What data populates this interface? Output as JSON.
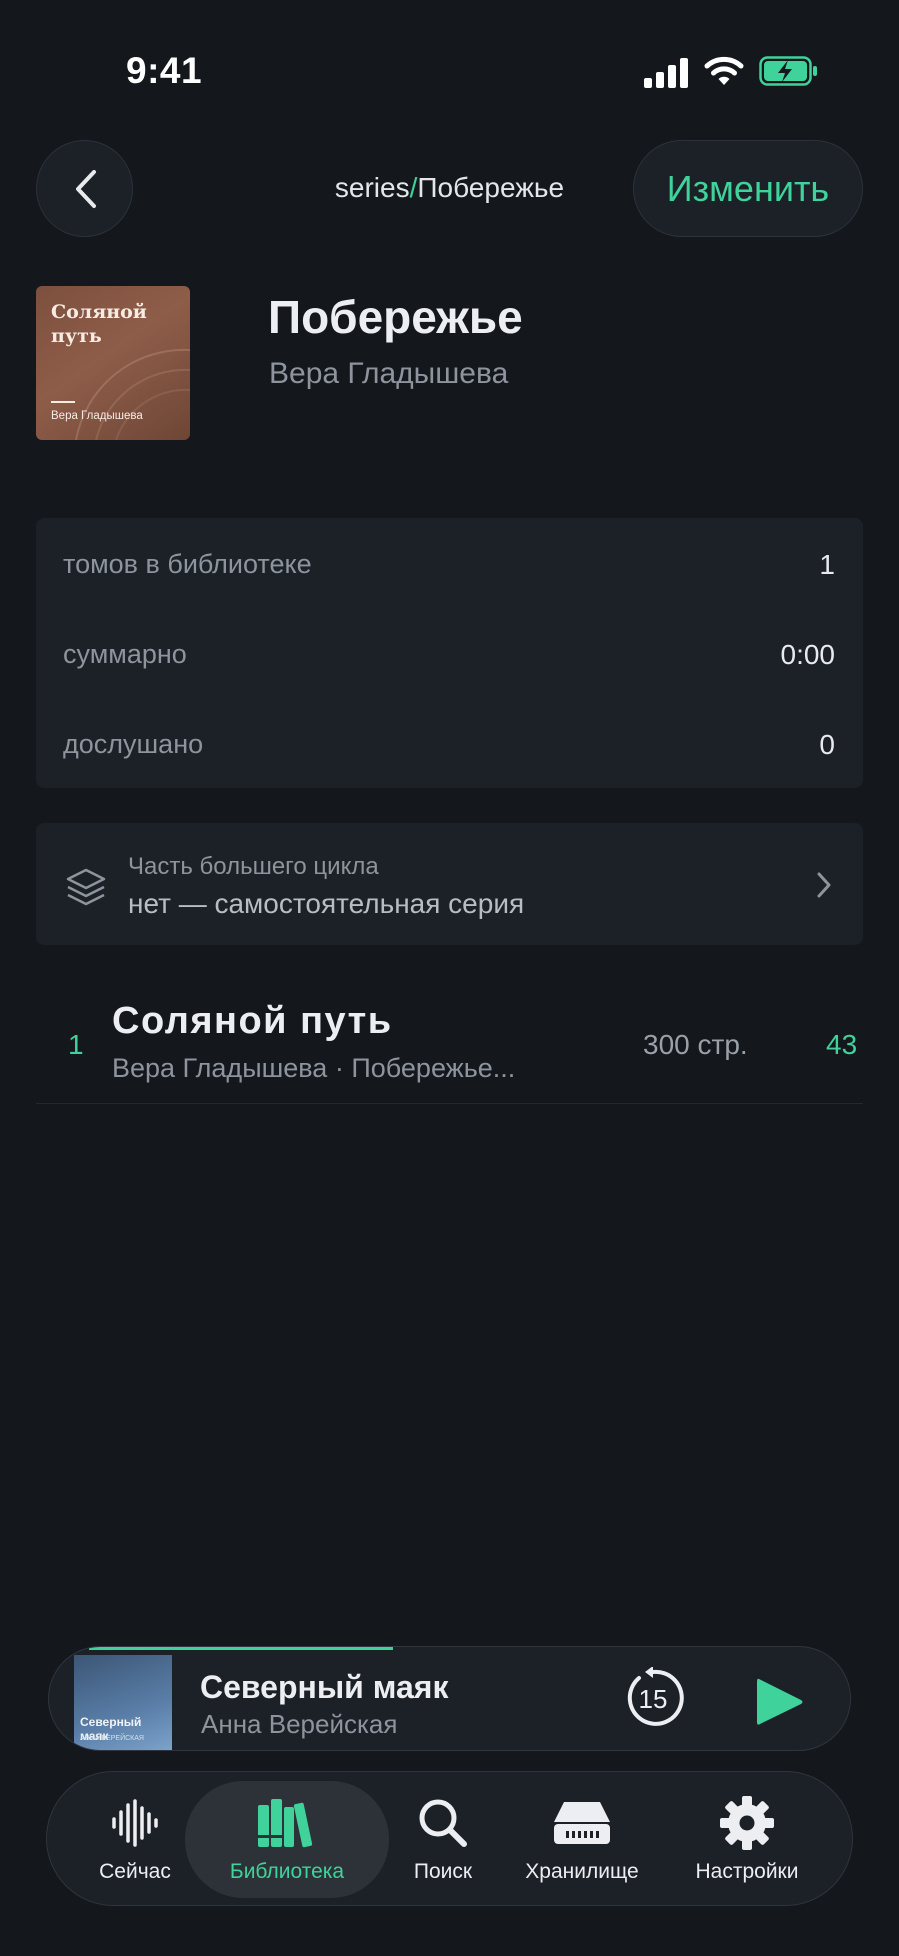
{
  "status_bar": {
    "time": "9:41",
    "icons": [
      "cellular-signal-icon",
      "wifi-icon",
      "battery-charging-icon"
    ]
  },
  "header": {
    "back_icon": "chevron-left-icon",
    "breadcrumb_root": "series",
    "breadcrumb_separator": "/",
    "breadcrumb_current": "Побережье",
    "edit_label": "Изменить"
  },
  "series": {
    "title": "Побережье",
    "author": "Вера Гладышева",
    "cover": {
      "title": "Соляной путь",
      "author": "Вера Гладышева"
    }
  },
  "stats": [
    {
      "label": "томов в библиотеке",
      "value": "1"
    },
    {
      "label": "суммарно",
      "value": "0:00"
    },
    {
      "label": "дослушано",
      "value": "0"
    }
  ],
  "cycle": {
    "icon": "layers-icon",
    "label": "Часть большего цикла",
    "value": "нет — самостоятельная серия"
  },
  "books": [
    {
      "index": "1",
      "title": "Соляной путь",
      "subtitle": "Вера Гладышева · Побережье...",
      "pages": "300 стр.",
      "percent": "43"
    }
  ],
  "player": {
    "title": "Северный маяк",
    "author": "Анна Верейская",
    "cover_title": "Северный маяк",
    "cover_subtitle": "АННА ВЕРЕЙСКАЯ",
    "progress_fraction": 0.42,
    "skip_seconds": "15",
    "skip_icon": "skip-back-15-icon",
    "play_icon": "play-icon"
  },
  "tabs": [
    {
      "label": "Сейчас",
      "icon": "waveform-icon",
      "active": false
    },
    {
      "label": "Библиотека",
      "icon": "books-icon",
      "active": true
    },
    {
      "label": "Поиск",
      "icon": "search-icon",
      "active": false
    },
    {
      "label": "Хранилище",
      "icon": "storage-drive-icon",
      "active": false
    },
    {
      "label": "Настройки",
      "icon": "gear-icon",
      "active": false
    }
  ],
  "colors": {
    "background": "#14171c",
    "card": "#1c2027",
    "accent": "#3fd29a",
    "text_primary": "#eceef1",
    "text_secondary": "#8d949e"
  }
}
